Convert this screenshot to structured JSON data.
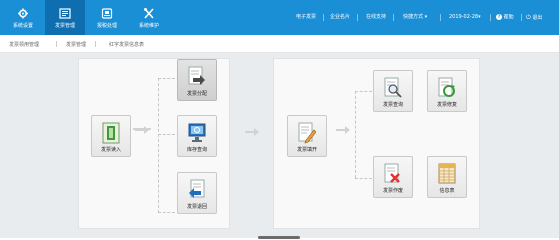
{
  "nav": {
    "items": [
      {
        "label": "系统设置",
        "icon": "gear-icon"
      },
      {
        "label": "发票管理",
        "icon": "invoice-icon"
      },
      {
        "label": "报税处理",
        "icon": "tax-report-icon"
      },
      {
        "label": "系统维护",
        "icon": "tools-icon"
      }
    ],
    "active": "发票管理"
  },
  "top_links": {
    "e_invoice": "电子发票",
    "company_card": "企业名片",
    "online_support": "在线支持",
    "shortcuts": "快捷方式",
    "date": "2019-02-28",
    "help": "帮助",
    "logout": "退出"
  },
  "breadcrumb": [
    "发票领用管理",
    "发票管理",
    "红字发票信息表"
  ],
  "tiles": {
    "invoice_read": "发票读入",
    "invoice_dist": "发票分配",
    "stock_query": "库存查询",
    "invoice_return": "发票退回",
    "invoice_issue": "发票填开",
    "invoice_query": "发票查询",
    "invoice_repair": "发票修复",
    "invoice_void": "发票作废",
    "info_table": "信息表"
  },
  "colors": {
    "topbar": "#1b8fd6",
    "topbar_active": "#0f6eb0",
    "content_bg": "#e9ecef"
  }
}
